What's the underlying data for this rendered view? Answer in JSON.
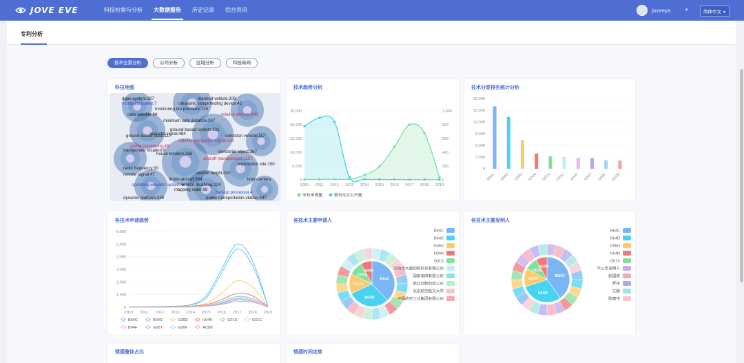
{
  "app": {
    "logo_text": "JOVE EVE"
  },
  "nav": {
    "items": [
      "科技检索与分析",
      "大数据报告",
      "历史记录",
      "综合资讯"
    ],
    "active_index": 1
  },
  "user": {
    "name": "joveeye",
    "language": "简体中文"
  },
  "subnav": {
    "tab": "专利分析"
  },
  "pills": {
    "items": [
      "技术全景分析",
      "公司分析",
      "区域分析",
      "科技新闻"
    ],
    "active_index": 0
  },
  "cards": {
    "map_title": "科技地图",
    "trend_title": "技术趋势分析",
    "rank_title": "技术分类排名统计分析",
    "apply_title": "各技术申请趋势",
    "applicants_title": "各技术主要申请人",
    "inventors_title": "各技术主要发明人",
    "bottom_left_title": "情感整体占比",
    "bottom_mid_title": "情感时间走势"
  },
  "tech_map": {
    "labels": [
      {
        "text": "dgps system.397",
        "color": "#222"
      },
      {
        "text": "manned vehicle.209",
        "color": "#222"
      },
      {
        "text": "multipath/scatter.7",
        "color": "#3344cc"
      },
      {
        "text": "ultrasonic range finding device.42",
        "color": "#222"
      },
      {
        "text": "monitoring tire pressure.725",
        "color": "#222"
      },
      {
        "text": "data satellite.64",
        "color": "#222"
      },
      {
        "text": "relative altitude.848",
        "color": "#dd2244"
      },
      {
        "text": "minimum safe distance.307",
        "color": "#222"
      },
      {
        "text": "ground-based system.632",
        "color": "#222"
      },
      {
        "text": "acoustic signal.484",
        "color": "#222"
      },
      {
        "text": "ground-based radar.117",
        "color": "#222"
      },
      {
        "text": "detection vehicle.117",
        "color": "#222"
      },
      {
        "text": "satellite navigation signal.530",
        "color": "#dd2266"
      },
      {
        "text": "global positioning.48",
        "color": "#dd2266"
      },
      {
        "text": "terrestrial object.367",
        "color": "#222"
      },
      {
        "text": "transponder location.9",
        "color": "#222"
      },
      {
        "text": "house location.268",
        "color": "#222"
      },
      {
        "text": "aircraft management.1157",
        "color": "#dd2244"
      },
      {
        "text": "radio frequency.30",
        "color": "#222"
      },
      {
        "text": "exploration site.150",
        "color": "#222"
      },
      {
        "text": "remote signal.47",
        "color": "#222"
      },
      {
        "text": "aircraft height.332",
        "color": "#222"
      },
      {
        "text": "drone aircraft.564",
        "color": "#222"
      },
      {
        "text": "lidar camera.",
        "color": "#222"
      },
      {
        "text": "operating elevator system.6",
        "color": "#3344cc"
      },
      {
        "text": "vehicle disabling.224",
        "color": "#222"
      },
      {
        "text": "mapping radar.68",
        "color": "#222"
      },
      {
        "text": "backup processor.4",
        "color": "#3344cc"
      },
      {
        "text": "public transportation station.497",
        "color": "#222"
      },
      {
        "text": "dynamic platform.338",
        "color": "#222"
      }
    ]
  },
  "trend_chart": {
    "type": "line",
    "x": [
      "2010",
      "2011",
      "2012",
      "2013",
      "2014",
      "2015",
      "2016",
      "2017",
      "2018",
      "2019"
    ],
    "y_left_ticks": [
      "25,000",
      "20,000",
      "15,000",
      "10,000",
      "5,000",
      "0"
    ],
    "y_right_ticks": [
      "1,000",
      "800",
      "600",
      "400",
      "200",
      "0"
    ],
    "series": [
      {
        "name": "专利申请量",
        "color": "#7ee0a0",
        "values": [
          120,
          150,
          180,
          260,
          1700,
          4800,
          12000,
          20000,
          17000,
          800
        ]
      },
      {
        "name": "期刊论文公开量",
        "color": "#4dd0e1",
        "values": [
          19500,
          22500,
          21000,
          900,
          200,
          100,
          80,
          60,
          40,
          30
        ]
      }
    ],
    "ylim": [
      0,
      25000
    ]
  },
  "rank_chart": {
    "type": "bar",
    "categories": [
      "B64C",
      "B64D",
      "G05D",
      "H04N",
      "G01S",
      "G01C",
      "B64F",
      "G06T",
      "G06F",
      "A01M"
    ],
    "values": [
      16000,
      13300,
      7400,
      3900,
      3200,
      3000,
      2800,
      2700,
      2200,
      2100
    ],
    "colors": [
      "#7ab6f5",
      "#49d3f2",
      "#ffca6b",
      "#f07878",
      "#83df9a",
      "#b9ecff",
      "#e6b8f2",
      "#b4a8f2",
      "#9bd5f8",
      "#f4a0a7"
    ],
    "y_ticks": [
      "18,000",
      "15,000",
      "12,000",
      "9,000",
      "6,000",
      "3,000",
      "0"
    ],
    "ylim": [
      0,
      18000
    ]
  },
  "apply_chart": {
    "type": "line",
    "x": [
      "2010",
      "2011",
      "2012",
      "2013",
      "2014",
      "2015",
      "2016",
      "2017",
      "2018",
      "2019"
    ],
    "y_ticks": [
      "6,000",
      "5,000",
      "4,000",
      "3,000",
      "2,000",
      "1,000",
      "0"
    ],
    "ylim": [
      0,
      6000
    ],
    "series": [
      {
        "name": "B64C",
        "color": "#7ab6f5",
        "values": [
          30,
          40,
          60,
          90,
          200,
          900,
          3000,
          5000,
          3700,
          100
        ]
      },
      {
        "name": "B64D",
        "color": "#49d3f2",
        "values": [
          25,
          35,
          50,
          80,
          180,
          700,
          2700,
          4600,
          3300,
          90
        ]
      },
      {
        "name": "G05D",
        "color": "#ffca6b",
        "values": [
          15,
          20,
          30,
          50,
          100,
          300,
          1100,
          2100,
          1600,
          50
        ]
      },
      {
        "name": "H04N",
        "color": "#f07878",
        "values": [
          10,
          15,
          20,
          40,
          80,
          200,
          600,
          1100,
          900,
          40
        ]
      },
      {
        "name": "G01S",
        "color": "#83df9a",
        "values": [
          10,
          12,
          18,
          30,
          60,
          150,
          450,
          850,
          700,
          30
        ]
      },
      {
        "name": "G01C",
        "color": "#b9ecff",
        "values": [
          8,
          10,
          15,
          25,
          50,
          140,
          400,
          800,
          650,
          25
        ]
      },
      {
        "name": "B64F",
        "color": "#e6b8f2",
        "values": [
          6,
          8,
          12,
          20,
          40,
          120,
          350,
          700,
          600,
          20
        ]
      },
      {
        "name": "G06T",
        "color": "#b4a8f2",
        "values": [
          5,
          7,
          10,
          18,
          35,
          100,
          300,
          650,
          500,
          20
        ]
      },
      {
        "name": "G06F",
        "color": "#9bd5f8",
        "values": [
          5,
          6,
          9,
          15,
          30,
          90,
          250,
          550,
          450,
          15
        ]
      },
      {
        "name": "A01M",
        "color": "#f4a0a7",
        "values": [
          4,
          5,
          8,
          12,
          25,
          80,
          220,
          450,
          400,
          10
        ]
      }
    ]
  },
  "applicants_chart": {
    "type": "pie",
    "legend": [
      {
        "name": "B64C",
        "color": "#7ab6f5"
      },
      {
        "name": "B64D",
        "color": "#49d3f2"
      },
      {
        "name": "G05D",
        "color": "#ffca6b"
      },
      {
        "name": "H04N",
        "color": "#f07878"
      },
      {
        "name": "G01S",
        "color": "#83df9a"
      },
      {
        "name": "深圳市大疆创新科技有限公司",
        "color": "#c4ecfb"
      },
      {
        "name": "国家电网有限公司",
        "color": "#8ee0ee"
      },
      {
        "name": "高巨创新科技公司",
        "color": "#b8eecb"
      },
      {
        "name": "北京航空航天大学",
        "color": "#f8c6cf"
      },
      {
        "name": "中国航空工业集团有限公司",
        "color": "#f6a8b5"
      }
    ],
    "inner": [
      {
        "name": "B64C",
        "value": 38,
        "color": "#7ab6f5"
      },
      {
        "name": "B64D",
        "value": 30,
        "color": "#49d3f2"
      },
      {
        "name": "G05D",
        "value": 14,
        "color": "#ffca6b"
      },
      {
        "name": "G01S",
        "value": 10,
        "color": "#83df9a"
      },
      {
        "name": "H04N",
        "value": 8,
        "color": "#f07878"
      }
    ]
  },
  "inventors_chart": {
    "type": "pie",
    "legend": [
      {
        "name": "B64C",
        "color": "#7ab6f5"
      },
      {
        "name": "B64D",
        "color": "#49d3f2"
      },
      {
        "name": "G05D",
        "color": "#ffca6b"
      },
      {
        "name": "H04N",
        "color": "#f07878"
      },
      {
        "name": "G01S",
        "color": "#83df9a"
      },
      {
        "name": "不公告发明人",
        "color": "#c9a8ec"
      },
      {
        "name": "赵国成",
        "color": "#f6a8b5"
      },
      {
        "name": "罗伟",
        "color": "#b4a8f2"
      },
      {
        "name": "王鹏",
        "color": "#9ae8e0"
      },
      {
        "name": "陈建伟",
        "color": "#f8c6cf"
      }
    ],
    "inner": [
      {
        "name": "B64C",
        "value": 40,
        "color": "#7ab6f5"
      },
      {
        "name": "B64D",
        "value": 30,
        "color": "#49d3f2"
      },
      {
        "name": "G05D",
        "value": 13,
        "color": "#ffca6b"
      },
      {
        "name": "G01S",
        "value": 9,
        "color": "#83df9a"
      },
      {
        "name": "H04N",
        "value": 8,
        "color": "#f07878"
      }
    ]
  }
}
